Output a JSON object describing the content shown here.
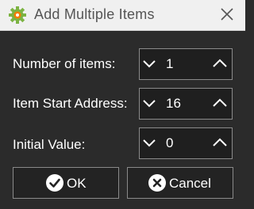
{
  "window": {
    "title": "Add Multiple Items"
  },
  "fields": [
    {
      "label": "Number of items:",
      "value": "1"
    },
    {
      "label": "Item Start Address:",
      "value": "16"
    },
    {
      "label": "Initial Value:",
      "value": "0"
    }
  ],
  "buttons": {
    "ok_label": "OK",
    "cancel_label": "Cancel"
  },
  "colors": {
    "background": "#2b2b2b",
    "titlebar": "#f0f0f0",
    "field_bg": "#1f1f1f",
    "border": "#8a8a8a",
    "app_icon_green": "#7cb342",
    "app_icon_orange": "#f57c00"
  },
  "icons": {
    "app": "gear-icon",
    "close": "close-icon",
    "decrement": "chevron-down-icon",
    "increment": "chevron-up-icon",
    "ok": "check-circle-icon",
    "cancel": "x-circle-icon"
  }
}
